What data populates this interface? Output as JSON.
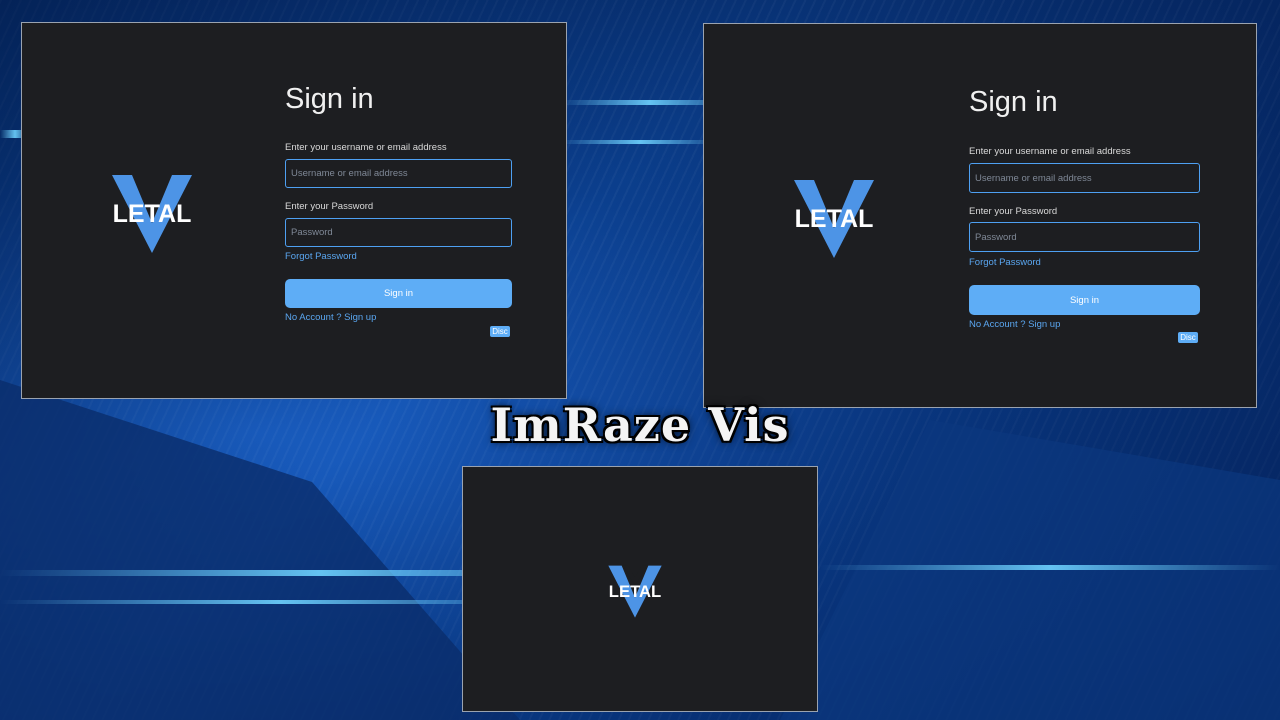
{
  "colors": {
    "accent": "#5eadf6",
    "panel": "#1d1e21",
    "logo_blue": "#4d94e6"
  },
  "logo": {
    "text": "LETAL",
    "icon": "letal-v-logo-icon"
  },
  "signin": {
    "title": "Sign in",
    "username_label": "Enter your username or email address",
    "username_placeholder": "Username or email address",
    "password_label": "Enter your Password",
    "password_placeholder": "Password",
    "forgot_link": "Forgot Password",
    "submit_label": "Sign in",
    "signup_link": "No Account ? Sign up",
    "disc_label": "Disc"
  },
  "watermark": {
    "text": "ImRaze Vis"
  }
}
